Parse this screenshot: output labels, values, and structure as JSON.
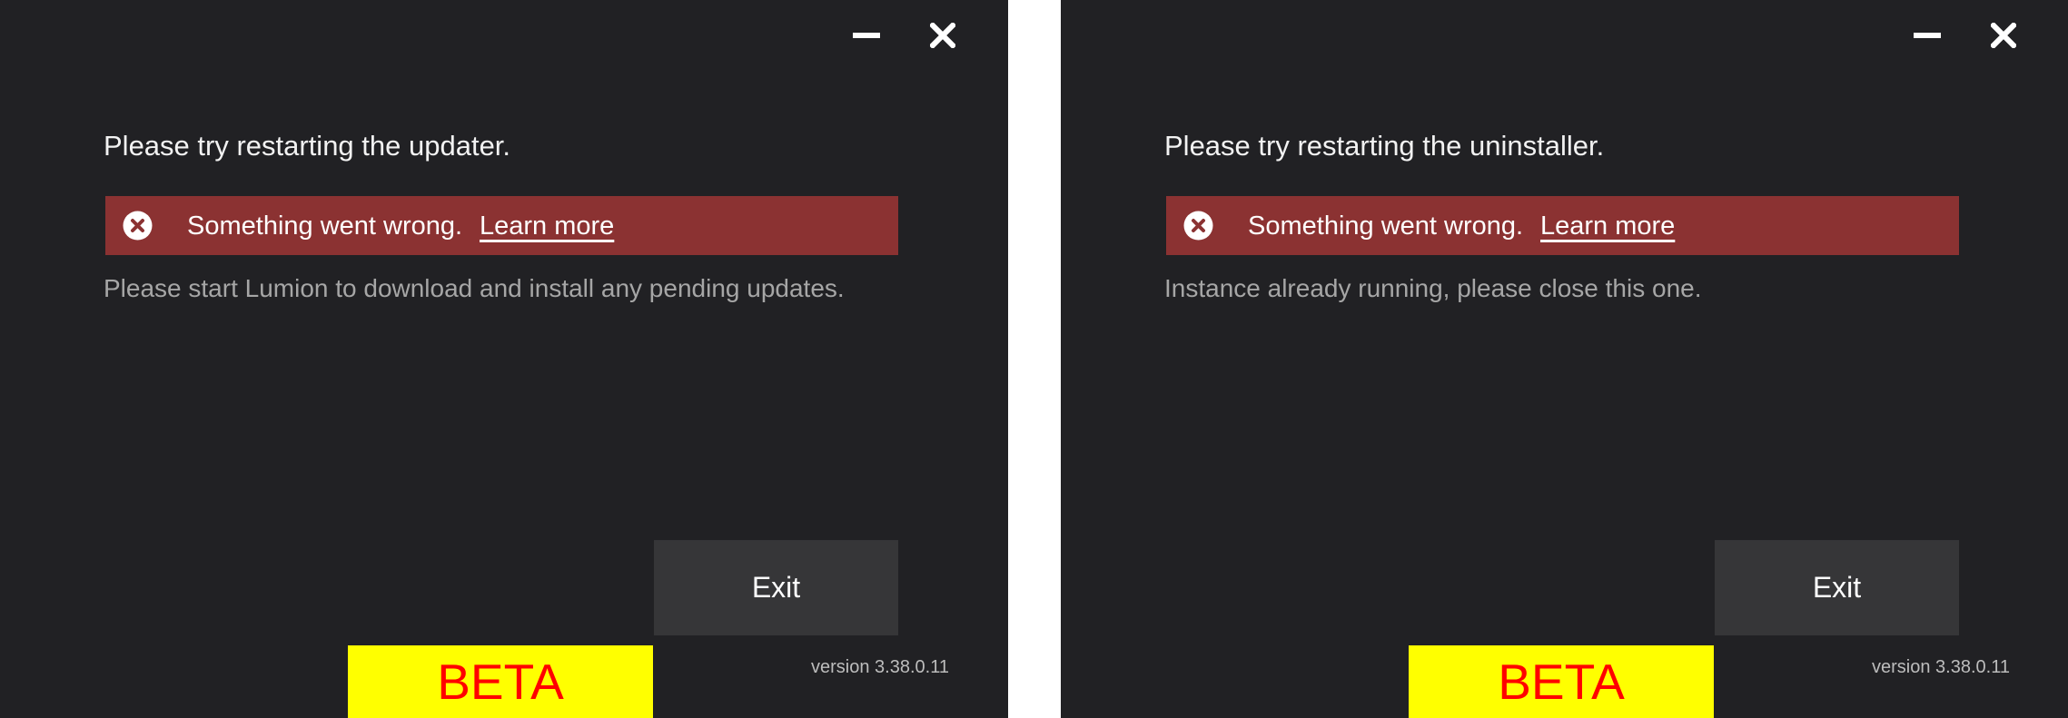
{
  "dialogs": [
    {
      "headline": "Please try restarting the updater.",
      "error_message": "Something went wrong.",
      "learn_more": "Learn more",
      "detail": "Please start Lumion to download and install any pending updates.",
      "exit_label": "Exit",
      "beta_label": "BETA",
      "version": "version 3.38.0.11"
    },
    {
      "headline": "Please try restarting the uninstaller.",
      "error_message": "Something went wrong.",
      "learn_more": "Learn more",
      "detail": "Instance already running, please close this one.",
      "exit_label": "Exit",
      "beta_label": "BETA",
      "version": "version 3.38.0.11"
    }
  ],
  "icons": {
    "minimize": "minimize-icon",
    "close": "close-icon",
    "error": "error-circle-x-icon"
  },
  "colors": {
    "window_bg": "#212124",
    "error_banner": "#8b3232",
    "exit_button": "#363638",
    "beta_bg": "#ffff00",
    "beta_text": "#ff0000"
  }
}
